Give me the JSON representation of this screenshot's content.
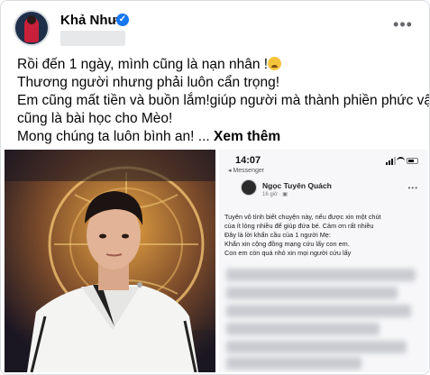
{
  "post": {
    "author": "Khả Như",
    "more_label": "•••",
    "lines": [
      "Rồi đến 1 ngày, mình cũng là nạn nhân !",
      "Thương người nhưng phải luôn cẩn trọng!",
      "Em cũng mất tiền và buồn lắm!giúp người mà thành phiền phức vậy",
      "cũng là bài học cho Mèo!",
      "Mong chúng ta luôn bình an! ..."
    ],
    "see_more": "Xem thêm",
    "emoji_icon": "sad-face-emoji"
  },
  "screenshot": {
    "time": "14:07",
    "back_app": "◂ Messenger",
    "author": "Ngọc Tuyên Quách",
    "post_time": "16 giờ · ▣",
    "more_label": "•••",
    "lines": [
      "Tuyên vô tình biết chuyện này, nếu được xin một chút",
      "của ít lòng nhiều để giúp đứa bé. Cảm ơn rất nhiều",
      "Đây là lời khẩn cầu của 1 người Mẹ:",
      "Khẩn xin cộng đồng mạng cứu lấy con em.",
      "Con em còn quá nhỏ xin mọi người cứu lấy"
    ]
  },
  "colors": {
    "verified": "#1877f2",
    "text": "#050505",
    "secondary": "#65676b"
  }
}
